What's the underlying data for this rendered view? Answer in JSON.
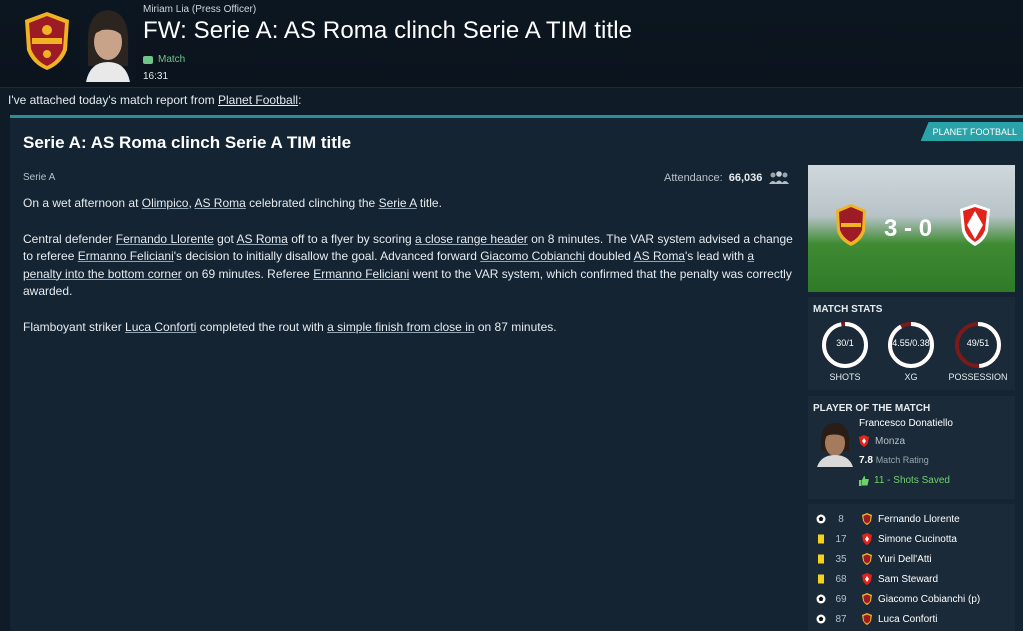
{
  "header": {
    "sender": "Miriam Lia (Press Officer)",
    "title": "FW: Serie A: AS Roma clinch Serie A TIM title",
    "tag": "Match",
    "time": "16:31"
  },
  "intro": {
    "prefix": "I've attached today's match report from ",
    "source": "Planet Football",
    "suffix": ":"
  },
  "article": {
    "badge": "PLANET FOOTBALL",
    "title": "Serie A: AS Roma clinch Serie A TIM title",
    "competition": "Serie A",
    "attendance_label": "Attendance:",
    "attendance_value": "66,036",
    "p1": {
      "a": "On a wet afternoon at ",
      "venue": "Olimpico",
      "b": ", ",
      "team": "AS Roma",
      "c": " celebrated clinching the ",
      "comp": "Serie A",
      "d": " title."
    },
    "p2": {
      "a": "Central defender ",
      "player1": "Fernando Llorente",
      "b": " got ",
      "team": "AS Roma",
      "c": " off to a flyer by scoring ",
      "goal1": "a close range header",
      "d": " on 8 minutes. The VAR system advised a change to referee ",
      "ref1": "Ermanno Feliciani",
      "e": "'s decision to initially disallow the goal. Advanced forward ",
      "player2": "Giacomo Cobianchi",
      "f": " doubled ",
      "team2": "AS Roma",
      "g": "'s lead with ",
      "goal2": "a penalty into the bottom corner",
      "h": " on 69 minutes. Referee ",
      "ref2": "Ermanno Feliciani",
      "i": " went to the VAR system, which confirmed that the penalty was correctly awarded."
    },
    "p3": {
      "a": "Flamboyant striker ",
      "player": "Luca Conforti",
      "b": " completed the rout with ",
      "goal": "a simple finish from close in",
      "c": " on 87 minutes."
    }
  },
  "score": {
    "home": "3",
    "sep": "-",
    "away": "0"
  },
  "match_stats": {
    "title": "MATCH STATS",
    "items": [
      {
        "label": "SHOTS",
        "value": "30/1",
        "home_share": 0.97
      },
      {
        "label": "XG",
        "value": "4.55/0.38",
        "home_share": 0.92
      },
      {
        "label": "POSSESSION",
        "value": "49/51",
        "home_share": 0.49
      }
    ]
  },
  "potm": {
    "title": "PLAYER OF THE MATCH",
    "name": "Francesco Donatiello",
    "team": "Monza",
    "rating": "7.8",
    "rating_label": "Match Rating",
    "shots": "11 - Shots Saved"
  },
  "events": [
    {
      "type": "goal",
      "minute": "8",
      "team": "roma",
      "player": "Fernando Llorente"
    },
    {
      "type": "yellow",
      "minute": "17",
      "team": "monza",
      "player": "Simone Cucinotta"
    },
    {
      "type": "yellow",
      "minute": "35",
      "team": "roma",
      "player": "Yuri Dell'Atti"
    },
    {
      "type": "yellow",
      "minute": "68",
      "team": "monza",
      "player": "Sam Steward"
    },
    {
      "type": "goal",
      "minute": "69",
      "team": "roma",
      "player": "Giacomo Cobianchi (p)"
    },
    {
      "type": "goal",
      "minute": "87",
      "team": "roma",
      "player": "Luca Conforti"
    }
  ],
  "colors": {
    "accent": "#2aa3a8",
    "roma_red": "#9c1b25",
    "roma_gold": "#f0b323",
    "monza_red": "#e2231a",
    "gauge_track": "#7a1a1a",
    "gauge_fill": "#ffffff",
    "positive": "#6ed16b",
    "yellow_card": "#f2d21b"
  },
  "icons": {
    "club": "roma-crest-icon",
    "tag": "match-tag-icon",
    "attendance": "crowd-icon",
    "shots_saved": "thumbs-up-icon",
    "goal": "ball-icon",
    "yellow": "yellow-card-icon"
  }
}
